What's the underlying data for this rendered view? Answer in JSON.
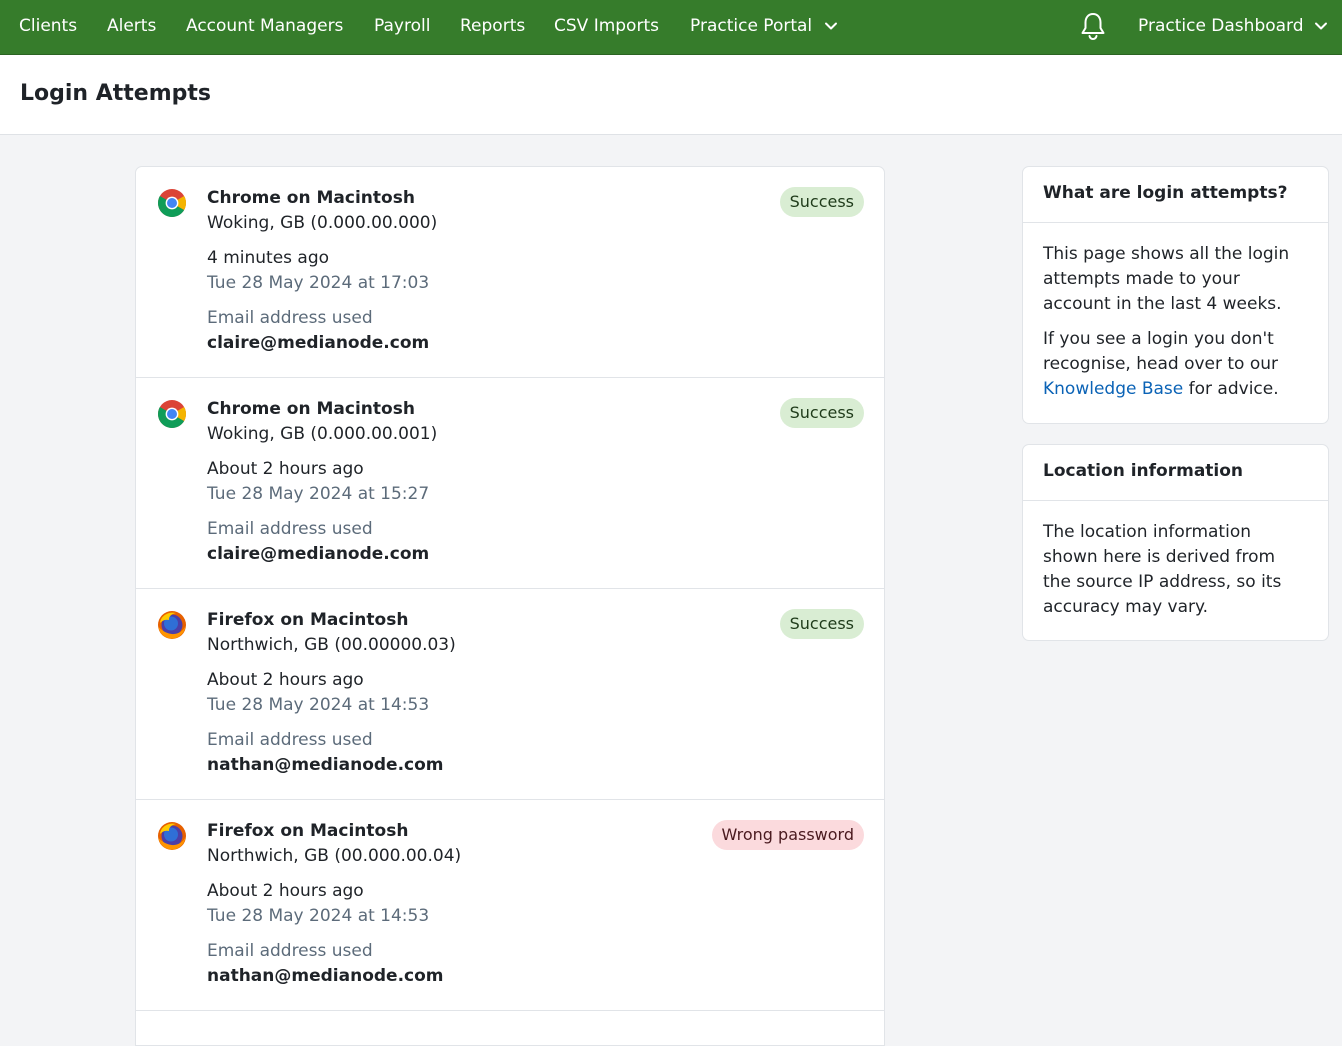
{
  "nav": {
    "items": [
      "Clients",
      "Alerts",
      "Account Managers",
      "Payroll",
      "Reports",
      "CSV Imports"
    ],
    "practice_portal": "Practice Portal",
    "practice_dashboard": "Practice Dashboard"
  },
  "page": {
    "title": "Login Attempts"
  },
  "attempts": [
    {
      "browser": "Chrome on Macintosh",
      "location": "Woking, GB (0.000.00.000)",
      "relative_time": "4 minutes ago",
      "absolute_time": "Tue 28 May 2024 at 17:03",
      "email_label": "Email address used",
      "email": "claire@medianode.com",
      "status": "Success",
      "icon": "chrome-icon"
    },
    {
      "browser": "Chrome on Macintosh",
      "location": "Woking, GB (0.000.00.001)",
      "relative_time": "About 2 hours ago",
      "absolute_time": "Tue 28 May 2024 at 15:27",
      "email_label": "Email address used",
      "email": "claire@medianode.com",
      "status": "Success",
      "icon": "chrome-icon"
    },
    {
      "browser": "Firefox on Macintosh",
      "location": "Northwich, GB (00.00000.03)",
      "relative_time": "About 2 hours ago",
      "absolute_time": "Tue 28 May 2024 at 14:53",
      "email_label": "Email address used",
      "email": "nathan@medianode.com",
      "status": "Success",
      "icon": "firefox-icon"
    },
    {
      "browser": "Firefox on Macintosh",
      "location": "Northwich, GB (00.000.00.04)",
      "relative_time": "About 2 hours ago",
      "absolute_time": "Tue 28 May 2024 at 14:53",
      "email_label": "Email address used",
      "email": "nathan@medianode.com",
      "status": "Wrong password",
      "icon": "firefox-icon"
    }
  ],
  "sidebar": {
    "what": {
      "title": "What are login attempts?",
      "p1": "This page shows all the login attempts made to your account in the last 4 weeks.",
      "p2_before": "If you see a login you don't recognise, head over to our ",
      "p2_link": "Knowledge Base",
      "p2_after": " for advice."
    },
    "location": {
      "title": "Location information",
      "p1": "The location information shown here is derived from the source IP address, so its accuracy may vary."
    }
  },
  "colors": {
    "nav_bg": "#367c2b",
    "success_bg": "#d9edd3",
    "fail_bg": "#fbdadd",
    "link": "#0b63b6"
  }
}
